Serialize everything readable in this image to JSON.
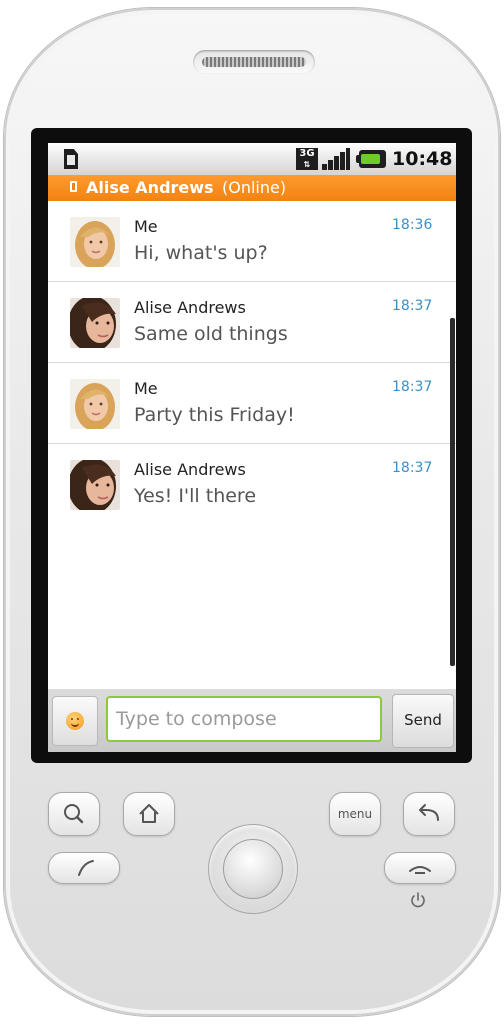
{
  "status_bar": {
    "network_label": "3G",
    "time": "10:48",
    "icons": [
      "sim-card-icon",
      "3g-icon",
      "signal-icon",
      "battery-icon"
    ]
  },
  "conversation": {
    "contact_name": "Alise Andrews",
    "status": "(Online)",
    "accent_color": "#f28312"
  },
  "messages": [
    {
      "sender": "Me",
      "text": "Hi, what's up?",
      "time": "18:36",
      "avatar": "blonde-woman-avatar"
    },
    {
      "sender": "Alise Andrews",
      "text": "Same old things",
      "time": "18:37",
      "avatar": "brunette-woman-avatar"
    },
    {
      "sender": "Me",
      "text": "Party this Friday!",
      "time": "18:37",
      "avatar": "blonde-woman-avatar"
    },
    {
      "sender": "Alise Andrews",
      "text": "Yes! I'll there",
      "time": "18:37",
      "avatar": "brunette-woman-avatar"
    }
  ],
  "compose": {
    "placeholder": "Type to compose",
    "send_label": "Send",
    "emoji_icon": "smiley-icon",
    "border_color": "#8dc63f"
  },
  "hardware_buttons": {
    "menu_label": "menu",
    "icons": [
      "search-icon",
      "home-icon",
      "call-icon",
      "back-icon",
      "end-call-icon",
      "power-icon"
    ]
  },
  "colors": {
    "timestamp": "#3d8fc4",
    "title_bar": "#f28312"
  }
}
